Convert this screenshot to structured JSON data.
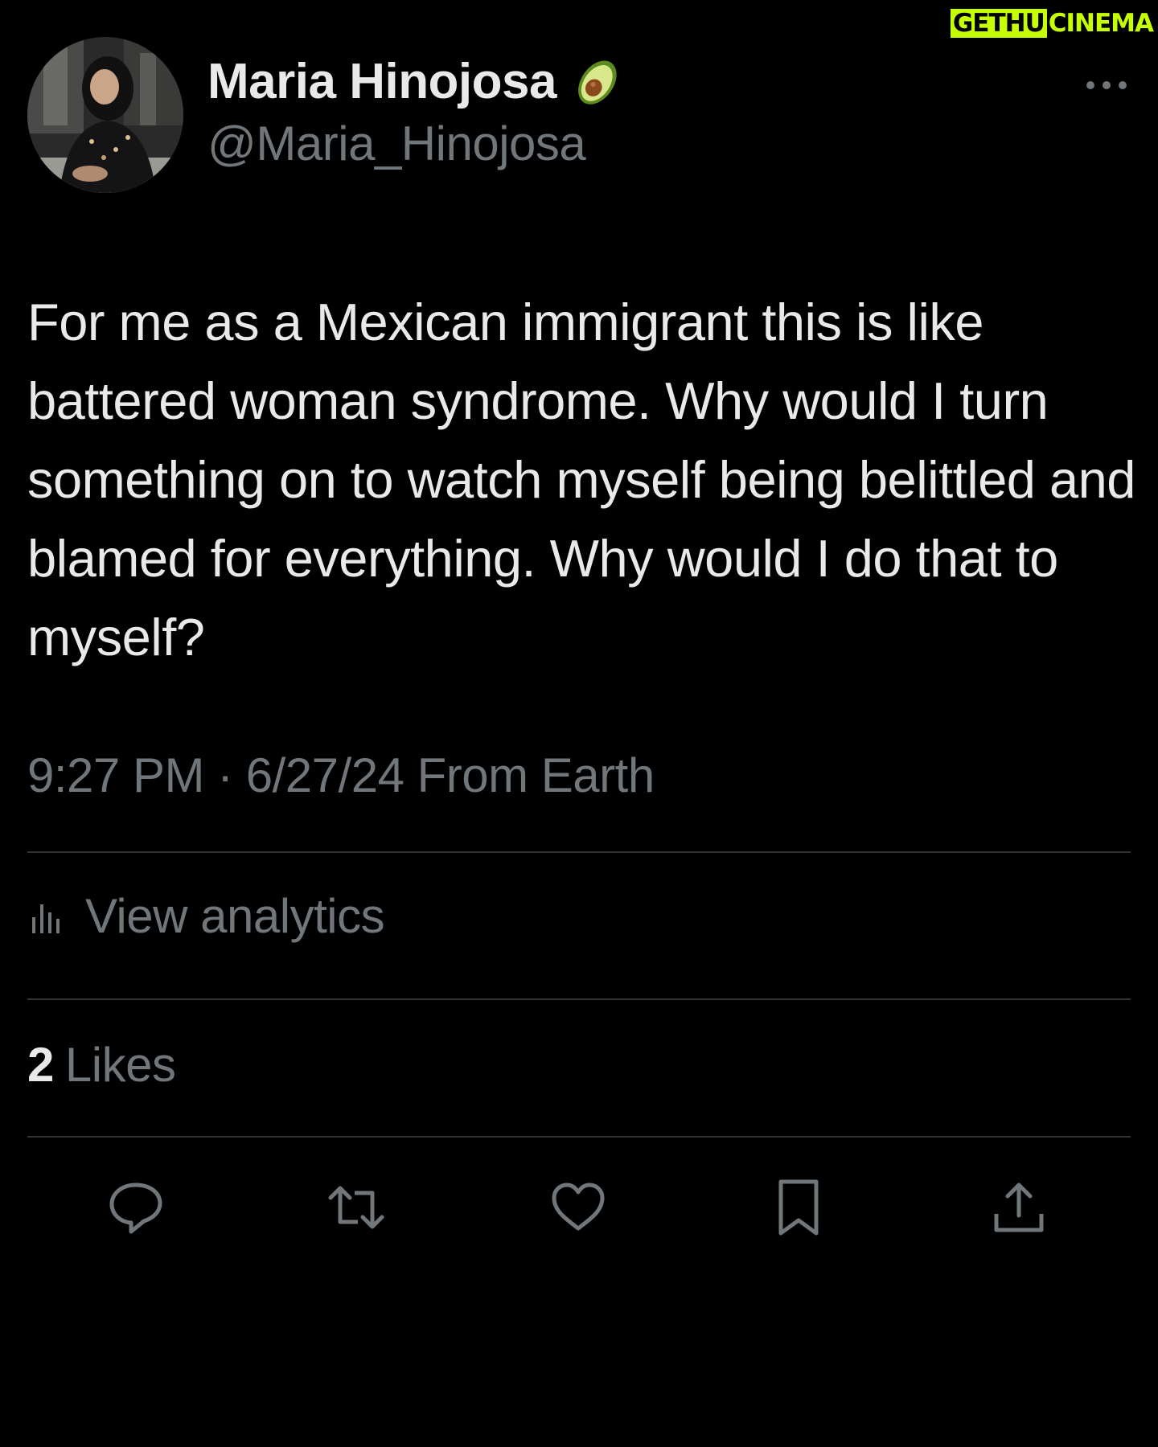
{
  "watermark": {
    "left": "GETHU",
    "right": "CINEMA"
  },
  "author": {
    "display_name": "Maria Hinojosa",
    "handle": "@Maria_Hinojosa",
    "badge_icon": "avocado-icon"
  },
  "tweet": {
    "text": "For me as a Mexican immigrant this is like battered woman syndrome. Why would I turn something on to watch myself being belittled and blamed for everything. Why would I do that to myself?",
    "timestamp": "9:27 PM · 6/27/24 From Earth"
  },
  "analytics": {
    "label": "View analytics",
    "icon": "bar-chart-icon"
  },
  "likes": {
    "count": "2",
    "label": "Likes"
  },
  "actions": [
    {
      "name": "reply",
      "icon": "reply-icon"
    },
    {
      "name": "retweet",
      "icon": "retweet-icon"
    },
    {
      "name": "like",
      "icon": "heart-icon"
    },
    {
      "name": "bookmark",
      "icon": "bookmark-icon"
    },
    {
      "name": "share",
      "icon": "share-icon"
    }
  ],
  "colors": {
    "background": "#000000",
    "text_primary": "#e7e9ea",
    "text_secondary": "#71767b",
    "divider": "#2f3336",
    "watermark_accent": "#c6ff00"
  }
}
